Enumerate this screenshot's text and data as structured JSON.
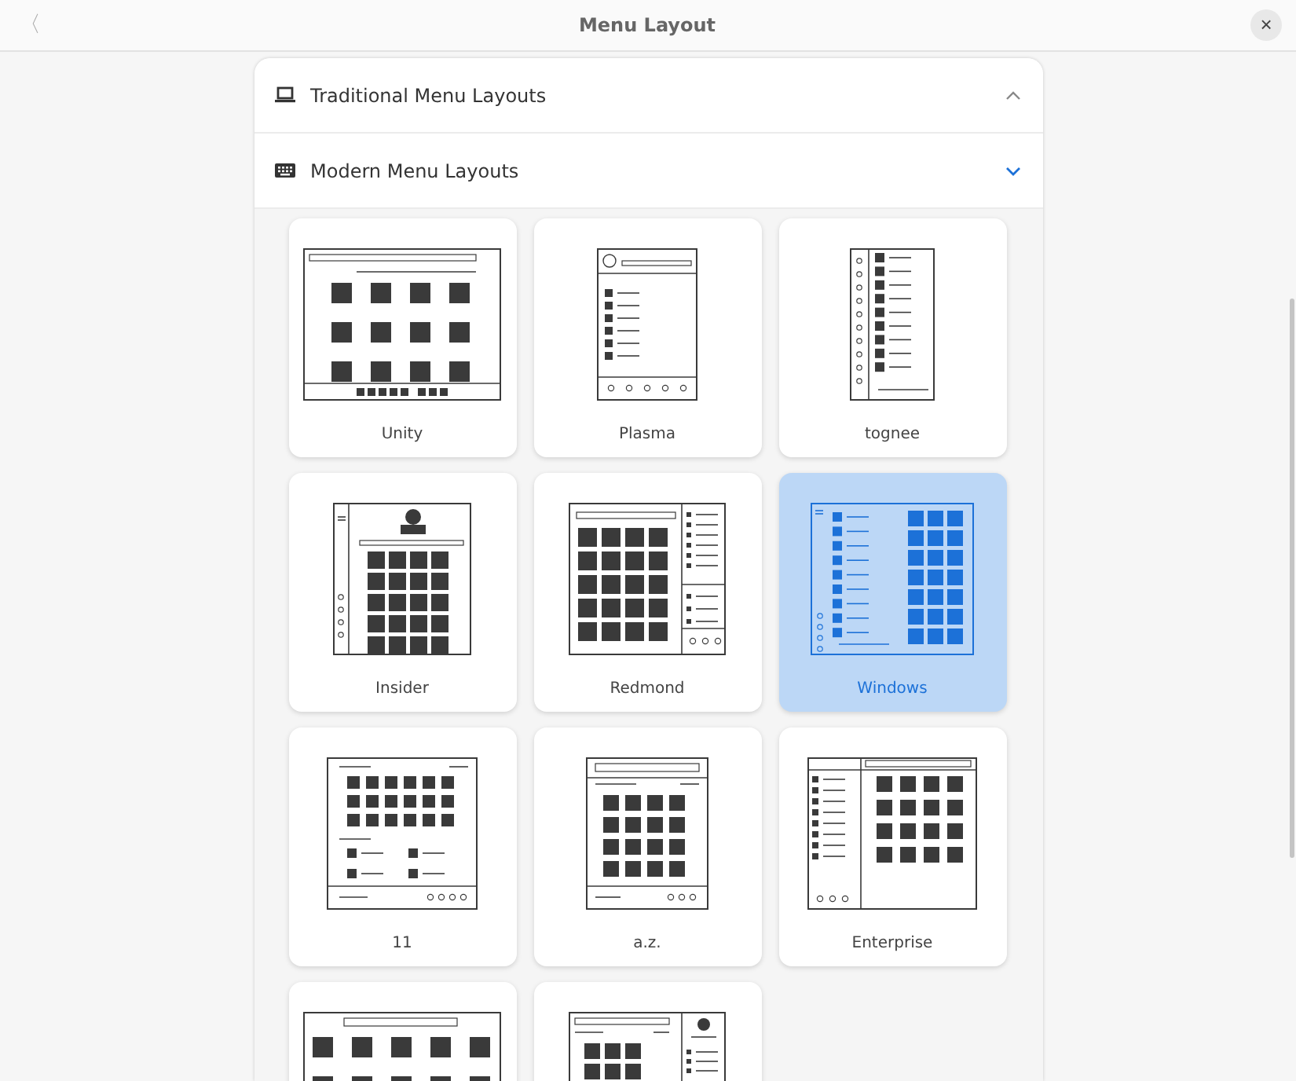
{
  "window": {
    "title": "Menu Layout",
    "back": "〈",
    "close": "×"
  },
  "sections": [
    {
      "label": "Traditional Menu Layouts",
      "expanded": false
    },
    {
      "label": "Modern Menu Layouts",
      "expanded": true
    }
  ],
  "layouts": [
    {
      "label": "Unity",
      "selected": false
    },
    {
      "label": "Plasma",
      "selected": false
    },
    {
      "label": "tognee",
      "selected": false
    },
    {
      "label": "Insider",
      "selected": false
    },
    {
      "label": "Redmond",
      "selected": false
    },
    {
      "label": "Windows",
      "selected": true
    },
    {
      "label": "11",
      "selected": false
    },
    {
      "label": "a.z.",
      "selected": false
    },
    {
      "label": "Enterprise",
      "selected": false
    },
    {
      "selected": false
    },
    {
      "selected": false
    }
  ]
}
